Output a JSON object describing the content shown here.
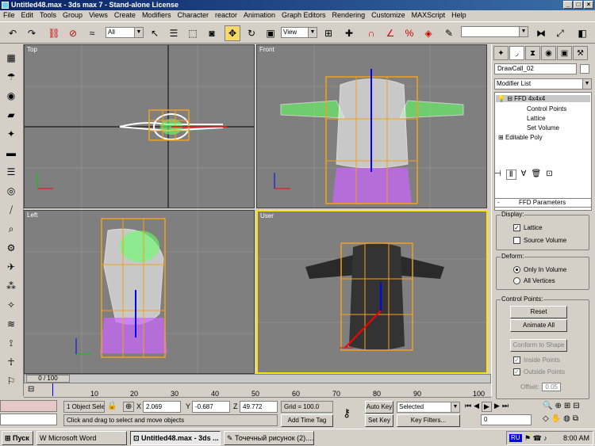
{
  "window": {
    "title": "Untitled48.max - 3ds max 7 - Stand-alone License"
  },
  "menu": [
    "File",
    "Edit",
    "Tools",
    "Group",
    "Views",
    "Create",
    "Modifiers",
    "Character",
    "reactor",
    "Animation",
    "Graph Editors",
    "Rendering",
    "Customize",
    "MAXScript",
    "Help"
  ],
  "toolbar": {
    "selection_filter": "All",
    "coord_system": "View"
  },
  "viewports": {
    "top": "Top",
    "front": "Front",
    "left": "Left",
    "user": "User"
  },
  "panel": {
    "object_name": "DrawCall_02",
    "modifier_list": "Modifier List",
    "stack": {
      "ffd": "FFD 4x4x4",
      "control_points": "Control Points",
      "lattice": "Lattice",
      "set_volume": "Set Volume",
      "editable_poly": "Editable Poly"
    },
    "rollout_title": "FFD Parameters",
    "display": {
      "title": "Display:",
      "lattice": "Lattice",
      "source_volume": "Source Volume"
    },
    "deform": {
      "title": "Deform:",
      "only_in_volume": "Only In Volume",
      "all_vertices": "All Vertices"
    },
    "control_points": {
      "title": "Control Points:",
      "reset": "Reset",
      "animate_all": "Animate All",
      "conform": "Conform to Shape",
      "inside": "Inside Points",
      "outside": "Outside Points",
      "offset_label": "Offset:",
      "offset_value": "0.05"
    }
  },
  "timeline": {
    "frame": "0 / 100",
    "ticks": [
      "10",
      "20",
      "30",
      "40",
      "50",
      "60",
      "70",
      "80",
      "90"
    ],
    "end": "100"
  },
  "status": {
    "selection": "1 Object Sele",
    "prompt": "Click and drag to select and move objects",
    "x_label": "X",
    "x": "2.069",
    "y_label": "Y",
    "y": "-0.687",
    "z_label": "Z",
    "z": "49.772",
    "grid": "Grid = 100.0",
    "add_time_tag": "Add Time Tag",
    "auto_key": "Auto Key",
    "set_key": "Set Key",
    "key_mode": "Selected",
    "key_filters": "Key Filters...",
    "current_frame": "0"
  },
  "taskbar": {
    "start": "Пуск",
    "task1": "Microsoft Word",
    "task2": "Untitled48.max - 3ds ...",
    "task3": "Точечный рисунок (2)....",
    "lang": "RU",
    "clock": "8:00 AM"
  },
  "colors": {
    "viewport_bg": "#7f7f7f",
    "lattice": "#f0a020",
    "mesh_white": "#ffffff",
    "mesh_green": "#66ff66",
    "mesh_purple": "#cc66ff",
    "active_border": "#ffe400"
  }
}
